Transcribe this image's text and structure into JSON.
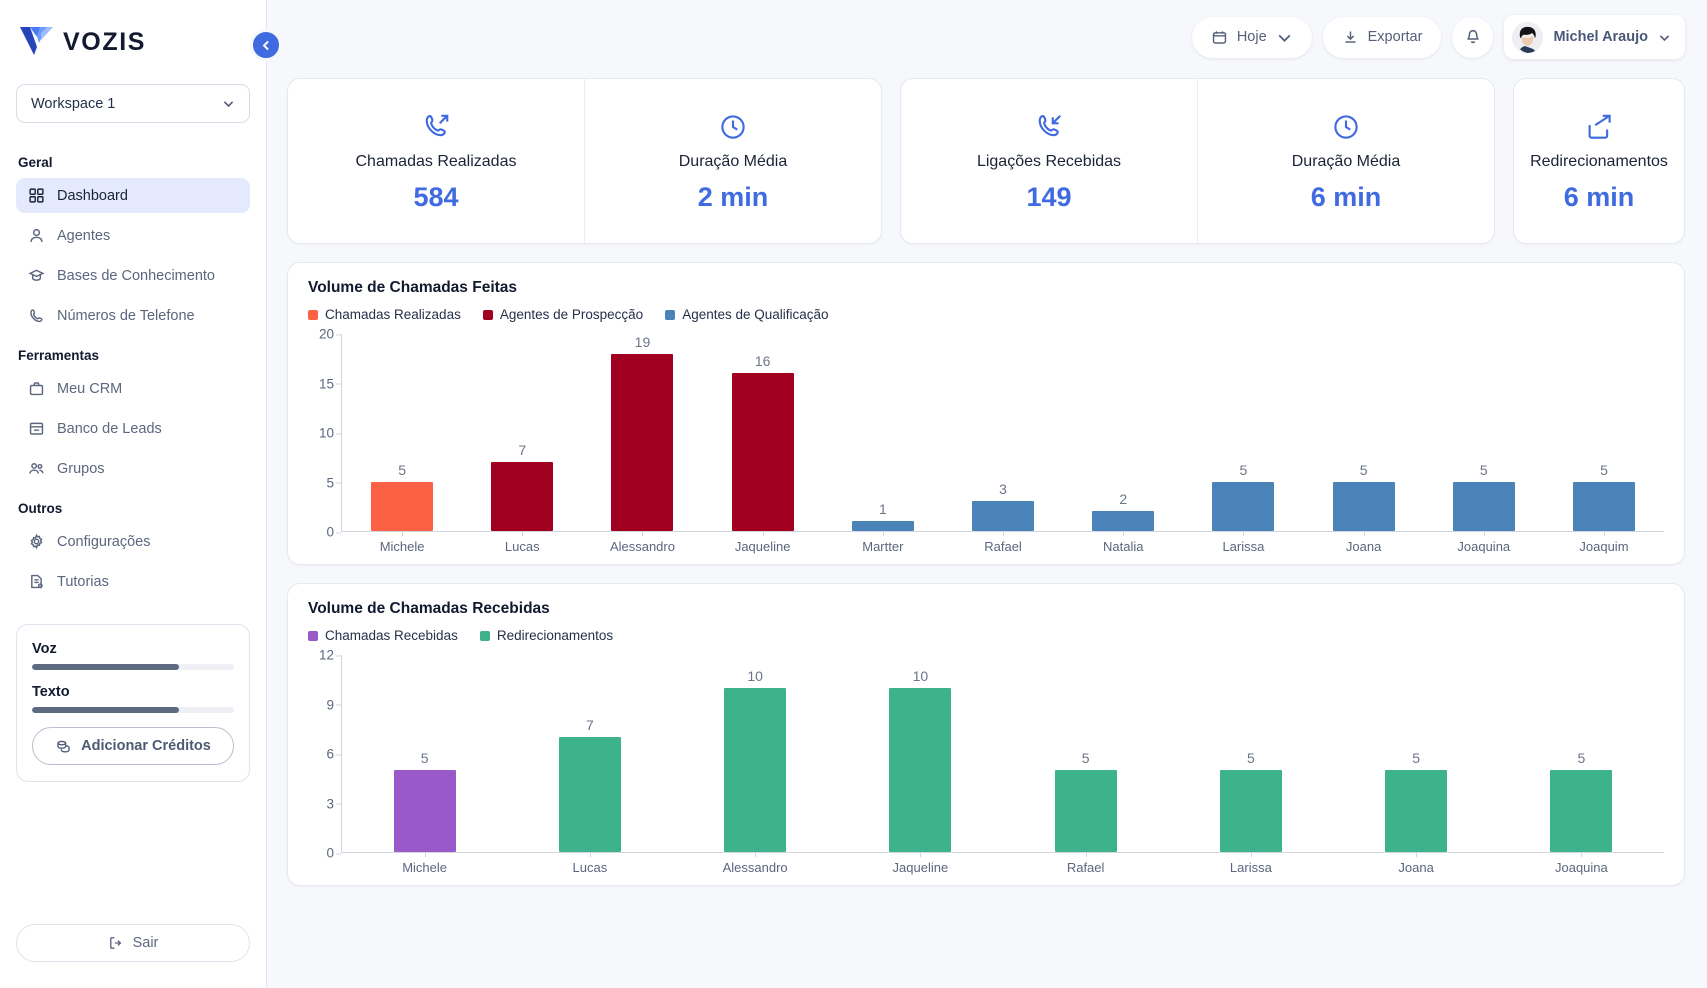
{
  "brand": {
    "name": "VOZIS"
  },
  "sidebar": {
    "workspace": {
      "label": "Workspace 1"
    },
    "groups": [
      {
        "title": "Geral",
        "items": [
          {
            "label": "Dashboard",
            "icon": "grid-icon",
            "active": true
          },
          {
            "label": "Agentes",
            "icon": "user-icon",
            "active": false
          },
          {
            "label": "Bases de Conhecimento",
            "icon": "graduation-cap-icon",
            "active": false
          },
          {
            "label": "Números de Telefone",
            "icon": "phone-icon",
            "active": false
          }
        ]
      },
      {
        "title": "Ferramentas",
        "items": [
          {
            "label": "Meu CRM",
            "icon": "briefcase-icon",
            "active": false
          },
          {
            "label": "Banco de Leads",
            "icon": "archive-icon",
            "active": false
          },
          {
            "label": "Grupos",
            "icon": "users-icon",
            "active": false
          }
        ]
      },
      {
        "title": "Outros",
        "items": [
          {
            "label": "Configurações",
            "icon": "gear-icon",
            "active": false
          },
          {
            "label": "Tutorias",
            "icon": "document-icon",
            "active": false
          }
        ]
      }
    ],
    "credits": {
      "voice_label": "Voz",
      "voice_percent": 73,
      "text_label": "Texto",
      "text_percent": 73,
      "add_button_label": "Adicionar Créditos"
    },
    "logout_label": "Sair"
  },
  "topbar": {
    "date_filter_label": "Hoje",
    "export_label": "Exportar",
    "user_name": "Michel Araujo"
  },
  "kpis": [
    {
      "title": "Chamadas Realizadas",
      "value": "584",
      "icon": "phone-outgoing-icon"
    },
    {
      "title": "Duração Média",
      "value": "2 min",
      "icon": "clock-icon"
    },
    {
      "title": "Ligações Recebidas",
      "value": "149",
      "icon": "phone-incoming-icon"
    },
    {
      "title": "Duração Média",
      "value": "6 min",
      "icon": "clock-icon"
    },
    {
      "title": "Redirecionamentos",
      "value": "6 min",
      "icon": "share-icon"
    }
  ],
  "colors": {
    "accent": "#3f6ae0",
    "orange": "#fb6144",
    "dark_red": "#a10021",
    "steel_blue": "#4a83b8",
    "purple": "#9a59c9",
    "green": "#3cb38a",
    "sidebar_active": "#e4e9fd"
  },
  "chart_data": [
    {
      "type": "bar",
      "title": "Volume de Chamadas Feitas",
      "xlabel": "",
      "ylabel": "",
      "ylim": [
        0,
        20
      ],
      "yticks": [
        0,
        5,
        10,
        15,
        20
      ],
      "grid": false,
      "legend_position": "top-left",
      "legend": [
        {
          "name": "Chamadas Realizadas",
          "color": "#fb6144"
        },
        {
          "name": "Agentes de Prospecção",
          "color": "#a10021"
        },
        {
          "name": "Agentes de Qualificação",
          "color": "#4a83b8"
        }
      ],
      "categories": [
        "Michele",
        "Lucas",
        "Alessandro",
        "Jaqueline",
        "Martter",
        "Rafael",
        "Natalia",
        "Larissa",
        "Joana",
        "Joaquina",
        "Joaquim"
      ],
      "values": [
        5,
        7,
        19,
        16,
        1,
        3,
        2,
        5,
        5,
        5,
        5
      ],
      "bar_colors": [
        "#fb6144",
        "#a10021",
        "#a10021",
        "#a10021",
        "#4a83b8",
        "#4a83b8",
        "#4a83b8",
        "#4a83b8",
        "#4a83b8",
        "#4a83b8",
        "#4a83b8"
      ]
    },
    {
      "type": "bar",
      "title": "Volume de Chamadas Recebidas",
      "xlabel": "",
      "ylabel": "",
      "ylim": [
        0,
        12
      ],
      "yticks": [
        0,
        3,
        6,
        9,
        12
      ],
      "grid": false,
      "legend_position": "top-left",
      "legend": [
        {
          "name": "Chamadas Recebidas",
          "color": "#9a59c9"
        },
        {
          "name": "Redirecionamentos",
          "color": "#3cb38a"
        }
      ],
      "categories": [
        "Michele",
        "Lucas",
        "Alessandro",
        "Jaqueline",
        "Rafael",
        "Larissa",
        "Joana",
        "Joaquina"
      ],
      "values": [
        5,
        7,
        10,
        10,
        5,
        5,
        5,
        5
      ],
      "bar_colors": [
        "#9a59c9",
        "#3cb38a",
        "#3cb38a",
        "#3cb38a",
        "#3cb38a",
        "#3cb38a",
        "#3cb38a",
        "#3cb38a"
      ]
    }
  ]
}
